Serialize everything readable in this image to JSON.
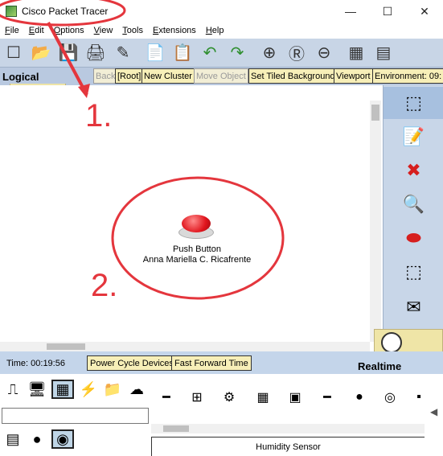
{
  "window": {
    "title": "Cisco Packet Tracer",
    "minimize": "—",
    "maximize": "☐",
    "close": "✕"
  },
  "menu": [
    "File",
    "Edit",
    "Options",
    "View",
    "Tools",
    "Extensions",
    "Help"
  ],
  "toolbar_icons": [
    "new-icon",
    "open-icon",
    "save-icon",
    "print-icon",
    "activity-wizard-icon",
    "pdu-list-icon",
    "copy-icon",
    "undo-icon",
    "redo-icon",
    "zoom-in-icon",
    "zoom-reset-icon",
    "zoom-out-icon",
    "palette-icon",
    "custom-device-icon"
  ],
  "logicalbar": {
    "label": "Logical",
    "back": "Back",
    "root": "[Root]",
    "new_cluster": "New Cluster",
    "move_object": "Move Object",
    "set_tiled_background": "Set Tiled Background",
    "viewport": "Viewport",
    "environment": "Environment: 09:"
  },
  "device": {
    "name": "Push Button",
    "owner": "Anna Mariella C. Ricafrente"
  },
  "annotations": {
    "step1": "1.",
    "step2": "2.",
    "color": "#e4363d"
  },
  "timebar": {
    "time": "Time: 00:19:56",
    "power_cycle": "Power Cycle Devices",
    "fast_forward": "Fast Forward Time",
    "mode": "Realtime"
  },
  "bottom": {
    "selected_device": "Humidity Sensor",
    "search_value": ""
  }
}
